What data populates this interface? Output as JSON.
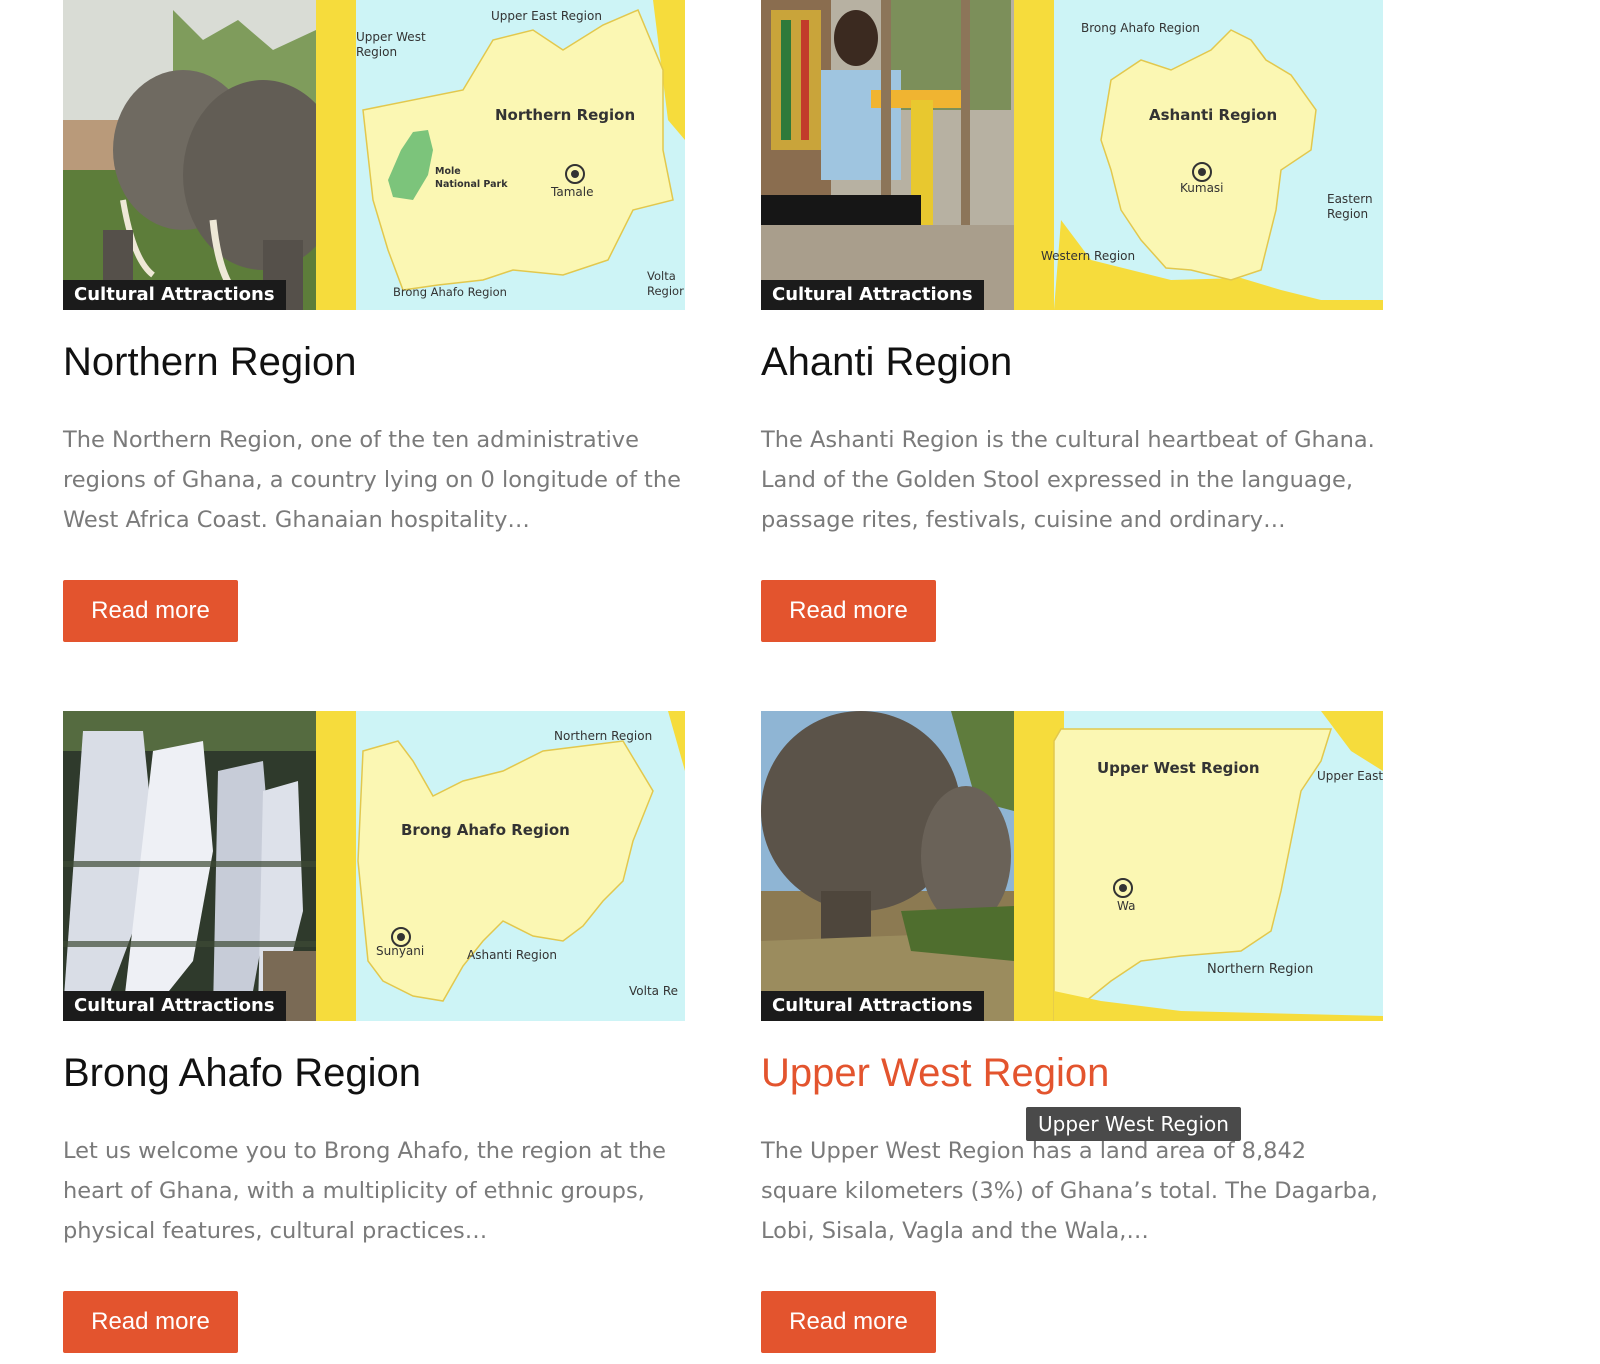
{
  "colors": {
    "accent": "#e3542e",
    "badge_bg": "#1b1b1b",
    "text_muted": "#7a7a7a",
    "map_sea": "#cdf4f6",
    "map_land": "#fbf7b3",
    "map_edge": "#f6dc3c",
    "park": "#7cc47b"
  },
  "read_more_label": "Read more",
  "cards": [
    {
      "badge": "Cultural Attractions",
      "title": "Northern Region",
      "excerpt": "The Northern Region, one of the ten administrative regions of Ghana, a country lying on 0 longitude of the West Africa Coast. Ghanaian hospitality…",
      "photo_icon": "elephants-photo",
      "map_labels": {
        "upper_west": "Upper West",
        "upper_west2": "Region",
        "upper_east": "Upper East Region",
        "main": "Northern Region",
        "park1": "Mole",
        "park2": "National Park",
        "city": "Tamale",
        "south": "Brong Ahafo Region",
        "east1": "Volta",
        "east2": "Regior"
      }
    },
    {
      "badge": "Cultural Attractions",
      "title": "Ahanti Region",
      "excerpt": "The Ashanti Region is the cultural heartbeat of Ghana. Land of the Golden Stool expressed in the language, passage rites, festivals, cuisine and ordinary…",
      "photo_icon": "kente-weaver-photo",
      "map_labels": {
        "north": "Brong Ahafo Region",
        "main": "Ashanti Region",
        "city": "Kumasi",
        "east1": "Eastern",
        "east2": "Region",
        "west": "Western Region"
      }
    },
    {
      "badge": "Cultural Attractions",
      "title": "Brong Ahafo Region",
      "excerpt": "Let us welcome you to Brong Ahafo, the region at the heart of Ghana, with a multiplicity of ethnic groups, physical features, cultural practices…",
      "photo_icon": "waterfall-photo",
      "map_labels": {
        "north": "Northern Region",
        "main": "Brong Ahafo Region",
        "city": "Sunyani",
        "south": "Ashanti Region",
        "east": "Volta Re"
      }
    },
    {
      "badge": "Cultural Attractions",
      "title": "Upper West Region",
      "excerpt": "The Upper West Region has a land area of 8,842 square kilometers (3%) of Ghana’s total. The Dagarba, Lobi, Sisala, Vagla and the Wala,…",
      "photo_icon": "balancing-rock-photo",
      "map_labels": {
        "main": "Upper West Region",
        "east": "Upper East",
        "city": "Wa",
        "south": "Northern Region"
      }
    }
  ],
  "tooltip": "Upper West Region"
}
